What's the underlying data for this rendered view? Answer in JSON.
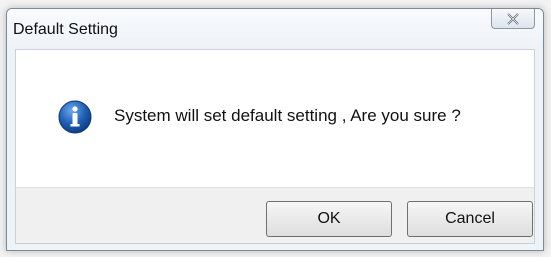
{
  "dialog": {
    "title": "Default Setting",
    "message": "System will set default setting , Are you sure ?",
    "icon": "info-icon",
    "ok_label": "OK",
    "cancel_label": "Cancel",
    "close_icon": "close-icon"
  },
  "colors": {
    "info_blue": "#1e5fb4",
    "content_bg": "#ffffff",
    "footer_bg": "#f0f0f0"
  }
}
